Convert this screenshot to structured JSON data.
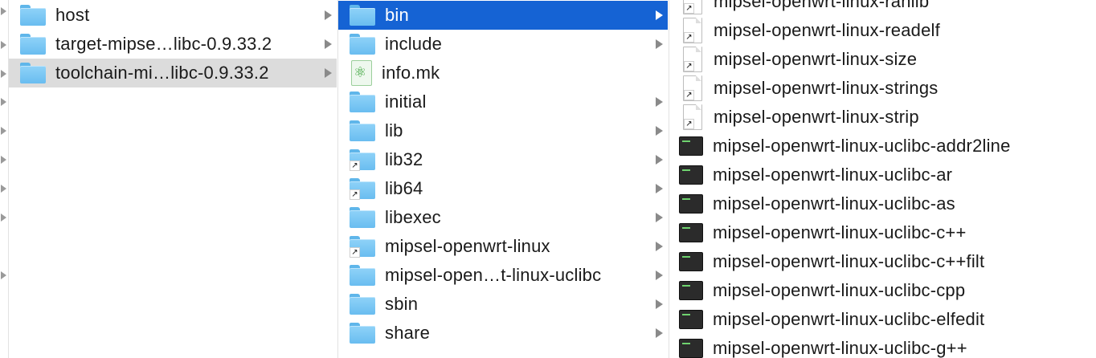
{
  "column1": {
    "items": [
      {
        "name": "host",
        "icon": "folder-icon"
      },
      {
        "name": "target-mipse…libc-0.9.33.2",
        "icon": "folder-icon"
      },
      {
        "name": "toolchain-mi…libc-0.9.33.2",
        "icon": "folder-icon",
        "selected": "inactive"
      }
    ]
  },
  "column2": {
    "items": [
      {
        "name": "bin",
        "icon": "folder-icon",
        "selected": "active"
      },
      {
        "name": "include",
        "icon": "folder-icon"
      },
      {
        "name": "info.mk",
        "icon": "makefile-icon"
      },
      {
        "name": "initial",
        "icon": "folder-icon"
      },
      {
        "name": "lib",
        "icon": "folder-icon"
      },
      {
        "name": "lib32",
        "icon": "folder-alias-icon"
      },
      {
        "name": "lib64",
        "icon": "folder-alias-icon"
      },
      {
        "name": "libexec",
        "icon": "folder-icon"
      },
      {
        "name": "mipsel-openwrt-linux",
        "icon": "folder-alias-icon"
      },
      {
        "name": "mipsel-open…t-linux-uclibc",
        "icon": "folder-icon"
      },
      {
        "name": "sbin",
        "icon": "folder-icon"
      },
      {
        "name": "share",
        "icon": "folder-icon"
      }
    ]
  },
  "column3": {
    "items": [
      {
        "name": "mipsel-openwrt-linux-ranlib",
        "icon": "alias-document-icon"
      },
      {
        "name": "mipsel-openwrt-linux-readelf",
        "icon": "alias-document-icon"
      },
      {
        "name": "mipsel-openwrt-linux-size",
        "icon": "alias-document-icon"
      },
      {
        "name": "mipsel-openwrt-linux-strings",
        "icon": "alias-document-icon"
      },
      {
        "name": "mipsel-openwrt-linux-strip",
        "icon": "alias-document-icon"
      },
      {
        "name": "mipsel-openwrt-linux-uclibc-addr2line",
        "icon": "terminal-executable-icon"
      },
      {
        "name": "mipsel-openwrt-linux-uclibc-ar",
        "icon": "terminal-executable-icon"
      },
      {
        "name": "mipsel-openwrt-linux-uclibc-as",
        "icon": "terminal-executable-icon"
      },
      {
        "name": "mipsel-openwrt-linux-uclibc-c++",
        "icon": "terminal-executable-icon"
      },
      {
        "name": "mipsel-openwrt-linux-uclibc-c++filt",
        "icon": "terminal-executable-icon"
      },
      {
        "name": "mipsel-openwrt-linux-uclibc-cpp",
        "icon": "terminal-executable-icon"
      },
      {
        "name": "mipsel-openwrt-linux-uclibc-elfedit",
        "icon": "terminal-executable-icon"
      },
      {
        "name": "mipsel-openwrt-linux-uclibc-g++",
        "icon": "terminal-executable-icon"
      }
    ]
  },
  "colors": {
    "selection_active": "#1563d4",
    "selection_inactive": "#dcdcdc",
    "folder": "#7cc7f4",
    "divider": "#e2e2e2"
  }
}
